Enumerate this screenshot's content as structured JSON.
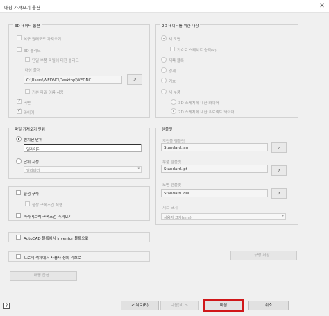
{
  "window": {
    "title": "대상 가져오기 옵션",
    "close_glyph": "✕"
  },
  "import_3d": {
    "title": "3D 데이터 옵션",
    "restore_original": "복구 원래모드 가져오기",
    "solids": "3D 솔리드",
    "single_part": "단일 부품 파일에 대한 솔리드",
    "target_folder_label": "대상 폴더",
    "target_folder_value": "C:\\Users\\WEDNC\\Desktop\\WEDNC",
    "use_default_name": "기본 파일 이름 사용",
    "surfaces": "곡면",
    "wires": "와이어"
  },
  "target_2d": {
    "title": "2D 데이터를 위한 대상",
    "new_drawing": "새 도면",
    "put_in_sketch": "기호로 스케치로 승격(P)",
    "title_block": "제목 블록",
    "border": "경계",
    "symbol": "기호",
    "new_part": "새 부품",
    "sketch_3d": "3D 스케치에 대한 와이어",
    "sketch_2d": "2D 스케치에 대한 프로젝트 와이어"
  },
  "units": {
    "title": "파일 가져오기 단위",
    "from_source": "원치된 단위",
    "from_source_value": "밀리미터",
    "specify": "단위 지정",
    "specify_value": "밀리미터"
  },
  "templates": {
    "title": "템플릿",
    "assembly_label": "조립품 템플릿",
    "assembly_value": "Standard.iam",
    "part_label": "부품 템플릿",
    "part_value": "Standard.ipt",
    "drawing_label": "도면 템플릿",
    "drawing_value": "Standard.idw",
    "sheet_size_label": "시트 크기",
    "sheet_size_value": "사용자 크기(mm)"
  },
  "options": {
    "constrain": "끝점 구속",
    "apply_constraints": "형상 구속조건 적용",
    "parametric": "파라메트릭 구속조건 가져오기",
    "autocad_blocks": "AutoCAD 블록에서 Inventor 블록으로",
    "promote_symbols": "프로시 객체에서 사용자 정의 기호로",
    "mapping_button": "매핑 옵션...",
    "config_button": "구성 저장..."
  },
  "footer": {
    "help_glyph": "?",
    "back": "< 뒤로(B)",
    "next": "다음(N) >",
    "finish": "마침",
    "cancel": "취소"
  },
  "colors": {
    "primary_border": "#d0181a",
    "dialog_bg": "#f0f0f0"
  }
}
